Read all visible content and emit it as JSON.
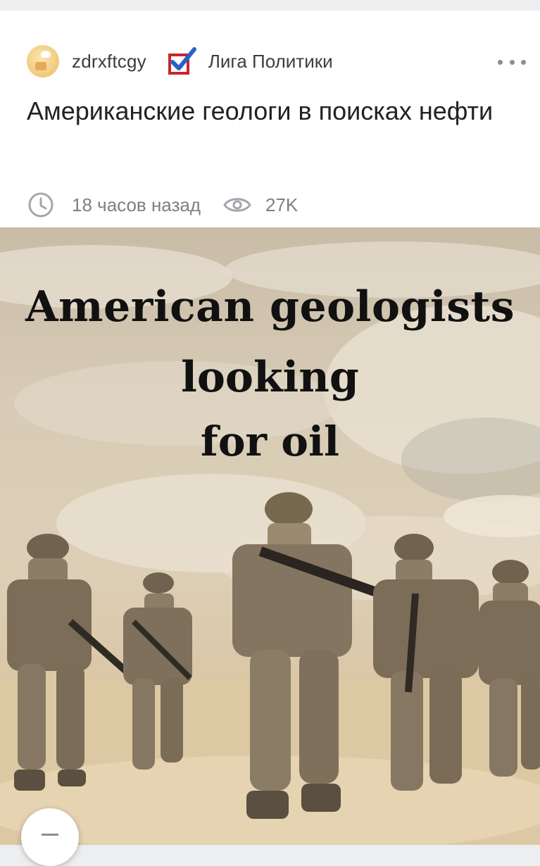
{
  "post": {
    "author": "zdrxftcgy",
    "community": "Лига Политики",
    "title": "Американские геологи в поисках нефти",
    "time_ago": "18 часов назад",
    "views": "27K"
  },
  "image": {
    "caption_line1": "American geologists",
    "caption_line2": "looking",
    "caption_line3": "for oil"
  },
  "icons": {
    "more": "more-dots-icon",
    "clock": "clock-icon",
    "eye": "eye-icon",
    "community": "checkbox-vote-icon",
    "collapse": "minus-icon"
  },
  "colors": {
    "background": "#eceef0",
    "card": "#ffffff",
    "text_primary": "#222222",
    "text_secondary": "#7c8084",
    "community_icon_red": "#c9252b",
    "community_icon_blue": "#2463c7"
  }
}
